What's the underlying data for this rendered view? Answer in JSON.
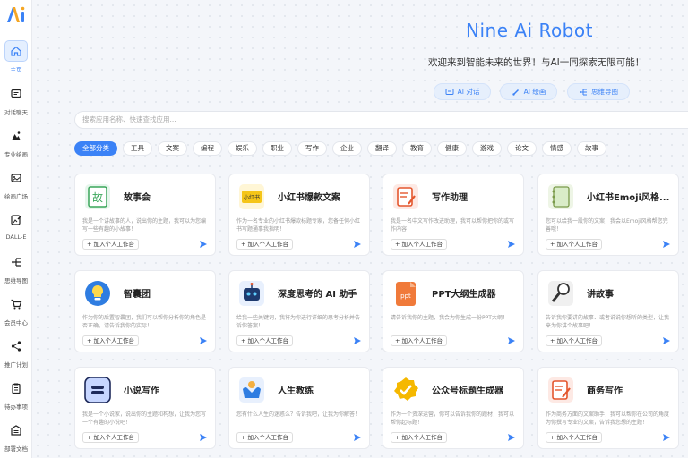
{
  "sidebar": {
    "items": [
      {
        "label": "主页",
        "icon": "home-icon"
      },
      {
        "label": "对话聊天",
        "icon": "chat-icon"
      },
      {
        "label": "专业绘画",
        "icon": "painting-icon"
      },
      {
        "label": "绘画广场",
        "icon": "gallery-icon"
      },
      {
        "label": "DALL-E",
        "icon": "image-edit-icon"
      },
      {
        "label": "思维导图",
        "icon": "mindmap-icon"
      },
      {
        "label": "会员中心",
        "icon": "cart-icon"
      },
      {
        "label": "推广计划",
        "icon": "share-icon"
      },
      {
        "label": "待办事项",
        "icon": "clipboard-icon"
      },
      {
        "label": "部署文档",
        "icon": "document-icon"
      }
    ]
  },
  "hero": {
    "title": "Nine Ai Robot",
    "subtitle": "欢迎来到智能未来的世界！与AI一同探索无限可能！",
    "buttons": [
      {
        "label": "AI 对话",
        "icon": "chat-icon"
      },
      {
        "label": "AI 绘画",
        "icon": "brush-icon"
      },
      {
        "label": "思维导图",
        "icon": "mindmap-icon"
      }
    ]
  },
  "search": {
    "placeholder": "搜索应用名称、快速查找应用..."
  },
  "categories": [
    "全部分类",
    "工具",
    "文案",
    "编程",
    "娱乐",
    "职业",
    "写作",
    "企业",
    "翻译",
    "教育",
    "健康",
    "游戏",
    "论文",
    "情感",
    "故事"
  ],
  "add_label": "加入个人工作台",
  "apps": [
    {
      "title": "故事会",
      "desc": "我是一个讲故事的人，说出你的主题，我可以为您编写一些有趣的小故事！",
      "icon": "story-book-icon"
    },
    {
      "title": "小红书爆款文案",
      "desc": "作为一名专业的小红书爆款标题专家，您备任何小红书写题通事我指明！",
      "icon": "xiaohongshu-icon"
    },
    {
      "title": "写作助理",
      "desc": "我是一名中文写作改进助理，我可以帮你把你的或写作内容！",
      "icon": "writing-icon"
    },
    {
      "title": "小红书Emoji风格...",
      "desc": "您可以给我一段你的文案，我会以Emoji风格帮您完善哦！",
      "icon": "notebook-icon"
    },
    {
      "title": "智囊团",
      "desc": "作为你的后置智囊团，我们可以帮你分析你的角色是否正确，请告诉我你的实际！",
      "icon": "lightbulb-icon"
    },
    {
      "title": "深度思考的 AI 助手",
      "desc": "给我一些关键词，我将为你进行详细的思考分析并告诉你答案！",
      "icon": "robot-icon"
    },
    {
      "title": "PPT大纲生成器",
      "desc": "请告诉我你的主题，我会为你生成一份PPT大纲！",
      "icon": "ppt-icon"
    },
    {
      "title": "讲故事",
      "desc": "告诉我你要讲的故事、或者说说你想听的类型，让我来为你讲个故事吧！",
      "icon": "microphone-icon"
    },
    {
      "title": "小说写作",
      "desc": "我是一个小说家，说出你的主题和构想，让我为您写一个有趣的小说吧！",
      "icon": "novel-icon"
    },
    {
      "title": "人生教练",
      "desc": "您有什么人生的迷惑么？告诉我吧，让我为你解答！",
      "icon": "coach-icon"
    },
    {
      "title": "公众号标题生成器",
      "desc": "作为一个资深运营，你可以告诉我你的题材，我可以帮你起标题！",
      "icon": "badge-check-icon"
    },
    {
      "title": "商务写作",
      "desc": "作为商务方面的文案助手，我可以帮你在公司的角度为你撰写专业的文案，告诉我您想的主题！",
      "icon": "business-writing-icon"
    }
  ],
  "colors": {
    "accent": "#3b82f6",
    "background": "#f4f6fa"
  }
}
